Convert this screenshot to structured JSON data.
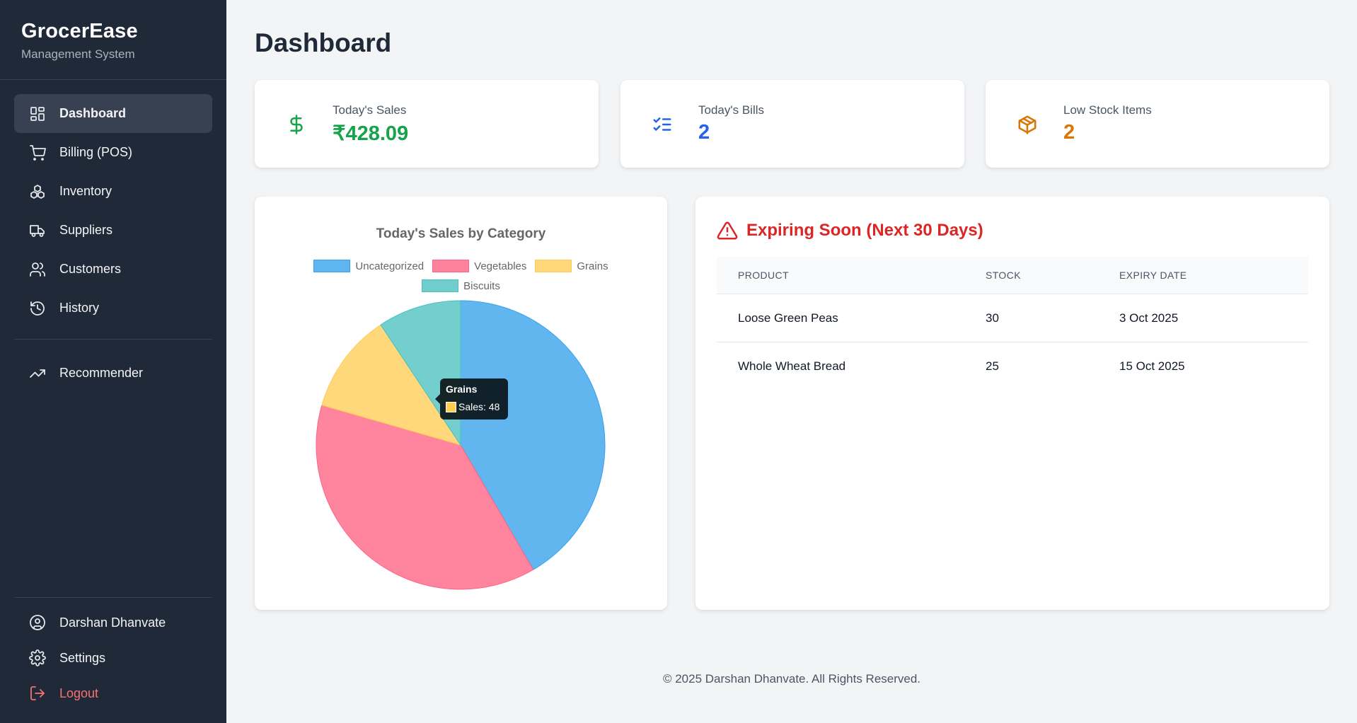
{
  "brand": {
    "title": "GrocerEase",
    "subtitle": "Management System"
  },
  "nav": [
    {
      "label": "Dashboard",
      "icon": "grid-icon"
    },
    {
      "label": "Billing (POS)",
      "icon": "cart-icon"
    },
    {
      "label": "Inventory",
      "icon": "boxes-icon"
    },
    {
      "label": "Suppliers",
      "icon": "truck-icon"
    },
    {
      "label": "Customers",
      "icon": "users-icon"
    },
    {
      "label": "History",
      "icon": "history-icon"
    },
    {
      "label": "Recommender",
      "icon": "trending-up-icon"
    }
  ],
  "bottom_nav": {
    "user": "Darshan Dhanvate",
    "settings": "Settings",
    "logout": "Logout"
  },
  "page": {
    "title": "Dashboard"
  },
  "stats": [
    {
      "label": "Today's Sales",
      "value": "₹428.09",
      "color": "#16a34a",
      "icon": "dollar-icon"
    },
    {
      "label": "Today's Bills",
      "value": "2",
      "color": "#2563eb",
      "icon": "list-checks-icon"
    },
    {
      "label": "Low Stock Items",
      "value": "2",
      "color": "#d97706",
      "icon": "package-icon"
    }
  ],
  "chart_data": {
    "type": "pie",
    "title": "Today's Sales by Category",
    "categories": [
      "Uncategorized",
      "Vegetables",
      "Grains",
      "Biscuits"
    ],
    "values": [
      178.09,
      162,
      48,
      40
    ],
    "colors": [
      "#36a2eb",
      "#ff6384",
      "#ffcd56",
      "#4bc0c0"
    ],
    "legend": "top",
    "tooltip": {
      "title": "Grains",
      "text": "Sales: 48"
    }
  },
  "expiring": {
    "title": "Expiring Soon (Next 30 Days)",
    "columns": [
      "PRODUCT",
      "STOCK",
      "EXPIRY DATE"
    ],
    "rows": [
      [
        "Loose Green Peas",
        "30",
        "3 Oct 2025"
      ],
      [
        "Whole Wheat Bread",
        "25",
        "15 Oct 2025"
      ]
    ]
  },
  "footer": "© 2025 Darshan Dhanvate. All Rights Reserved."
}
